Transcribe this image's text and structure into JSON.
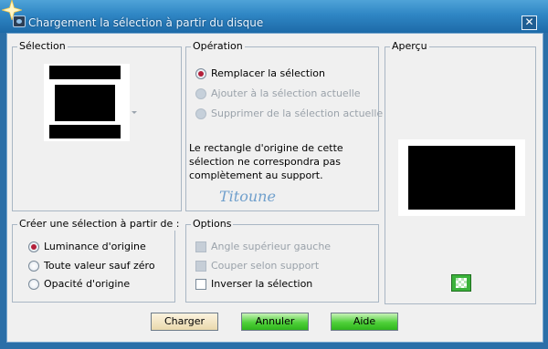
{
  "window": {
    "title": "Chargement la sélection à partir du disque",
    "close_glyph": "✕"
  },
  "selection_group": {
    "label": "Sélection"
  },
  "operation_group": {
    "label": "Opération",
    "options": [
      {
        "label": "Remplacer la sélection",
        "selected": true,
        "enabled": true
      },
      {
        "label": "Ajouter à la sélection actuelle",
        "selected": false,
        "enabled": false
      },
      {
        "label": "Supprimer de la sélection actuelle",
        "selected": false,
        "enabled": false
      }
    ],
    "note_lines": [
      "Le rectangle d'origine de cette",
      "sélection ne correspondra pas",
      "complètement au support."
    ],
    "signature": "Titoune"
  },
  "preview_group": {
    "label": "Aperçu"
  },
  "create_group": {
    "label": "Créer une sélection à partir de :",
    "options": [
      {
        "label": "Luminance d'origine",
        "selected": true
      },
      {
        "label": "Toute valeur sauf zéro",
        "selected": false
      },
      {
        "label": "Opacité d'origine",
        "selected": false
      }
    ]
  },
  "options_group": {
    "label": "Options",
    "checks": [
      {
        "label": "Angle supérieur gauche",
        "checked": false,
        "enabled": false
      },
      {
        "label": "Couper selon support",
        "checked": false,
        "enabled": false
      },
      {
        "label": "Inverser la sélection",
        "checked": false,
        "enabled": true
      }
    ]
  },
  "buttons": {
    "load": "Charger",
    "cancel": "Annuler",
    "help": "Aide"
  },
  "icons": {
    "title_icon": "sparkle-icon",
    "app_icon": "selection-app-icon",
    "preview_toggle": "checkerboard-icon",
    "dropdown": "chevron-down-icon"
  },
  "colors": {
    "title_bar": "#2f86c4",
    "radio_selected": "#b3203a",
    "green_button": "#4fd03a"
  }
}
